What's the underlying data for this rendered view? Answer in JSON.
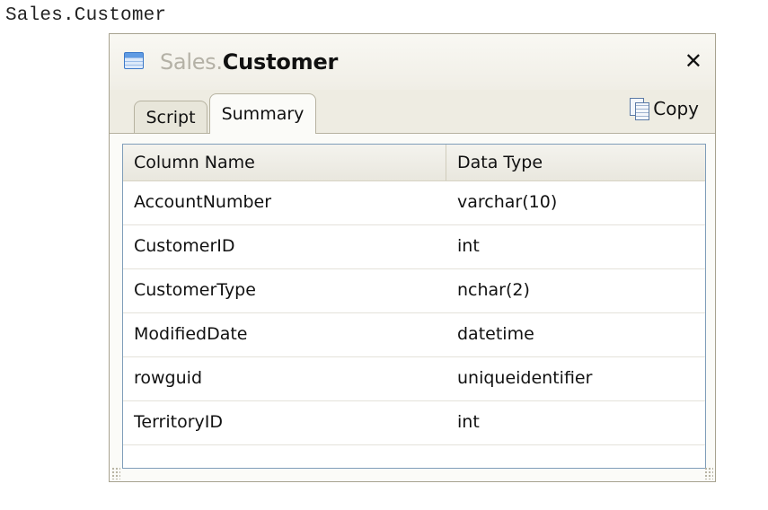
{
  "caption": "Sales.Customer",
  "window": {
    "schema": "Sales.",
    "table_name": "Customer",
    "close_glyph": "✕",
    "icon": "table-icon"
  },
  "tabs": [
    {
      "label": "Script",
      "active": false
    },
    {
      "label": "Summary",
      "active": true
    }
  ],
  "toolbar": {
    "copy_label": "Copy",
    "copy_icon": "copy-icon"
  },
  "grid": {
    "columns": [
      "Column Name",
      "Data Type"
    ],
    "rows": [
      {
        "name": "AccountNumber",
        "type": "varchar(10)"
      },
      {
        "name": "CustomerID",
        "type": "int"
      },
      {
        "name": "CustomerType",
        "type": "nchar(2)"
      },
      {
        "name": "ModifiedDate",
        "type": "datetime"
      },
      {
        "name": "rowguid",
        "type": "uniqueidentifier"
      },
      {
        "name": "TerritoryID",
        "type": "int"
      }
    ]
  },
  "colors": {
    "window_border": "#a7a28f",
    "window_bg": "#eeece2",
    "grid_border": "#7f9db9",
    "schema_text": "#b4b1a6"
  }
}
